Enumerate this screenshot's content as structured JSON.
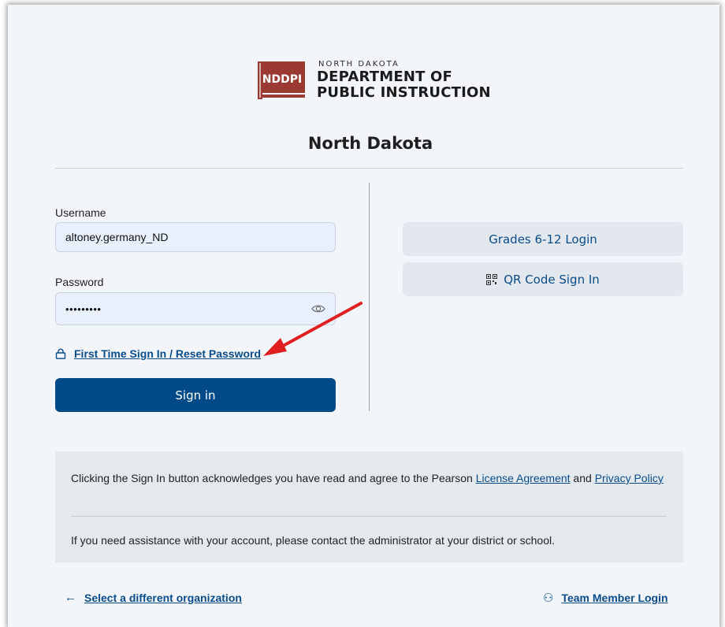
{
  "logo": {
    "acronym": "NDDPI",
    "small_text": "NORTH DAKOTA",
    "line1": "DEPARTMENT OF",
    "line2": "PUBLIC INSTRUCTION",
    "brand_color": "#9b3a32"
  },
  "org_name": "North Dakota",
  "form": {
    "username_label": "Username",
    "username_value": "altoney.germany_ND",
    "password_label": "Password",
    "password_value": "•••••••••",
    "reset_link": "First Time Sign In / Reset Password",
    "signin_label": "Sign in"
  },
  "alternatives": {
    "grades_label": "Grades 6-12 Login",
    "qr_label": "QR Code Sign In"
  },
  "notice": {
    "text_before": "Clicking the Sign In button acknowledges you have read and agree to the Pearson ",
    "license_link": "License Agreement",
    "text_and": " and ",
    "privacy_link": "Privacy Policy",
    "assistance": "If you need assistance with your account, please contact the administrator at your district or school."
  },
  "footer": {
    "back_icon": "←",
    "back_label": "Select a different organization",
    "team_icon": "⚇",
    "team_label": "Team Member Login"
  },
  "colors": {
    "primary": "#004a87",
    "link": "#0a4c8a",
    "annotation_arrow": "#e02020"
  }
}
